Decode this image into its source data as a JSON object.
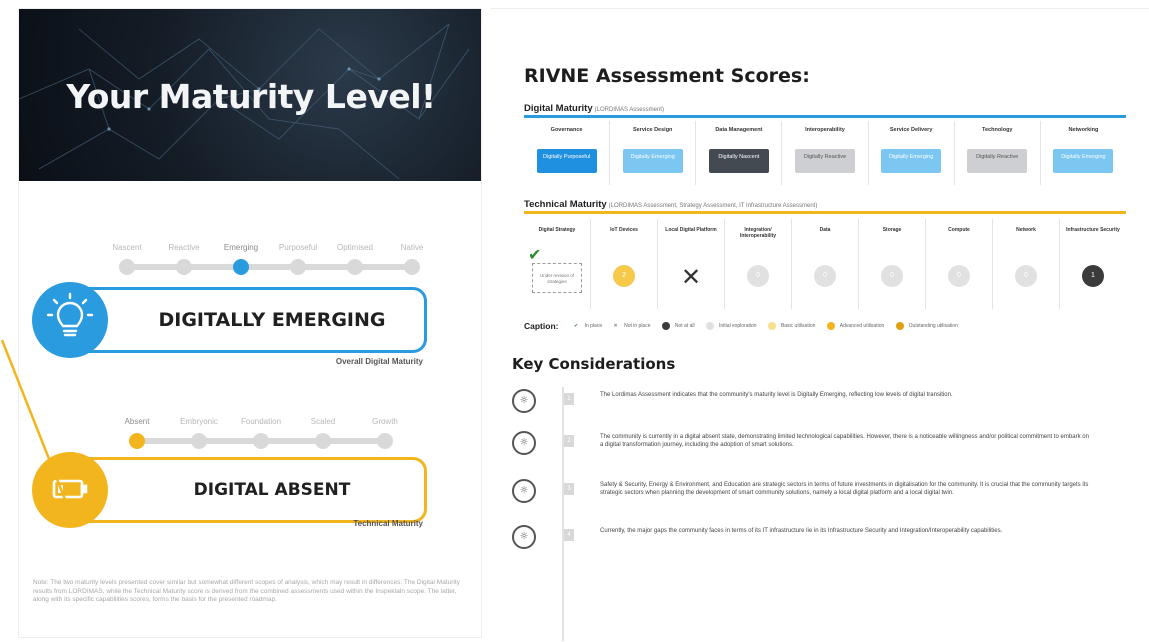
{
  "left": {
    "hero_title": "Your Maturity Level!",
    "digital": {
      "steps": [
        "Nascent",
        "Reactive",
        "Emerging",
        "Purposeful",
        "Optimised",
        "Native"
      ],
      "active_index": 2,
      "level_text": "DIGITALLY EMERGING",
      "caption": "Overall Digital Maturity",
      "icon": "lightbulb-icon",
      "color": "#2b9be0"
    },
    "technical": {
      "steps": [
        "Absent",
        "Embryonic",
        "Foundation",
        "Scaled",
        "Growth"
      ],
      "active_index": 0,
      "level_text": "DIGITAL ABSENT",
      "caption": "Technical Maturity",
      "icon": "battery-icon",
      "color": "#f2b51d"
    },
    "note": "Note: The two maturity levels presented cover similar but somewhat different scopes of analysis, which may result in differences. The Digital Maturity results from LORDIMAS, while the Technical Maturity score is derived from the combined assessments used within the Inspektaln scope. The latter, along with its specific capabilities scores, forms the basis for the presented roadmap."
  },
  "right": {
    "title": "RIVNE Assessment Scores:",
    "digital_maturity": {
      "heading": "Digital Maturity",
      "sub": "(LORDIMAS Assessment)",
      "line_color": "#2b9be0",
      "columns": [
        {
          "header": "Governance",
          "value": "Digitally Purposeful",
          "color": "#1f8fe0"
        },
        {
          "header": "Service Design",
          "value": "Digitally Emerging",
          "color": "#7cc6f2"
        },
        {
          "header": "Data Management",
          "value": "Digitally Nascent",
          "color": "#444a52"
        },
        {
          "header": "Interoperability",
          "value": "Digitally Reactive",
          "color": "#cdcfd2"
        },
        {
          "header": "Service Delivery",
          "value": "Digitally Emerging",
          "color": "#7cc6f2"
        },
        {
          "header": "Technology",
          "value": "Digitally Reactive",
          "color": "#cdcfd2"
        },
        {
          "header": "Networking",
          "value": "Digitally Emerging",
          "color": "#7cc6f2"
        }
      ]
    },
    "technical_maturity": {
      "heading": "Technical Maturity",
      "sub": "(LORDIMAS Assessment, Strategy Assessment, IT Infrastructure Assessment)",
      "line_color": "#f2b51d",
      "columns": [
        {
          "header": "Digital Strategy",
          "kind": "dashbox",
          "box_text": "Under revision of strategies"
        },
        {
          "header": "IoT Devices",
          "kind": "circle",
          "value": "2",
          "color": "#f6c94a"
        },
        {
          "header": "Local Digital Platform",
          "kind": "x"
        },
        {
          "header": "Integration/ Interoperability",
          "kind": "circle",
          "value": "0",
          "color": "#e1e1e1"
        },
        {
          "header": "Data",
          "kind": "circle",
          "value": "0",
          "color": "#e1e1e1"
        },
        {
          "header": "Storage",
          "kind": "circle",
          "value": "0",
          "color": "#e1e1e1"
        },
        {
          "header": "Compute",
          "kind": "circle",
          "value": "0",
          "color": "#e1e1e1"
        },
        {
          "header": "Network",
          "kind": "circle",
          "value": "0",
          "color": "#e1e1e1"
        },
        {
          "header": "Infrastructure Security",
          "kind": "circle",
          "value": "1",
          "color": "#3b3b3b"
        }
      ]
    },
    "caption": {
      "title": "Caption:",
      "items": [
        {
          "label": "In place",
          "color": "#2e8b2e",
          "icon": "check-icon"
        },
        {
          "label": "Not in place",
          "color": "#555555",
          "icon": "x-icon"
        },
        {
          "label": "Not at all",
          "color": "#3b3b3b",
          "icon": "circle-icon"
        },
        {
          "label": "Initial exploration",
          "color": "#e1e1e1",
          "icon": "circle-icon"
        },
        {
          "label": "Basic utilisation",
          "color": "#f8e08f",
          "icon": "circle-icon"
        },
        {
          "label": "Advanced utilisation",
          "color": "#f2b51d",
          "icon": "circle-icon"
        },
        {
          "label": "Outstanding utilisation",
          "color": "#e0a010",
          "icon": "circle-icon"
        }
      ]
    },
    "key_considerations": {
      "title": "Key Considerations",
      "items": [
        {
          "n": "1",
          "text": "The Lordimas Assessment indicates that the community's maturity level is Digitally Emerging, reflecting low levels of digital transition."
        },
        {
          "n": "2",
          "text": "The community is currently in a digital absent state, demonstrating limited technological capabilities. However, there is a noticeable willingness and/or political commitment to embark on a digital transformation journey, including the adoption of smart solutions."
        },
        {
          "n": "3",
          "text": "Safety & Security, Energy & Environment, and Education are strategic sectors in terms of future investments in digitalisation for the community. It is crucial that the community targets its strategic sectors when planning the development of smart community solutions, namely a local digital platform and a local digital twin."
        },
        {
          "n": "4",
          "text": "Currently, the major gaps the community faces in terms of its IT infrastructure lie in its Infrastructure Security and Integration/Interoperability capabilities."
        }
      ]
    }
  }
}
